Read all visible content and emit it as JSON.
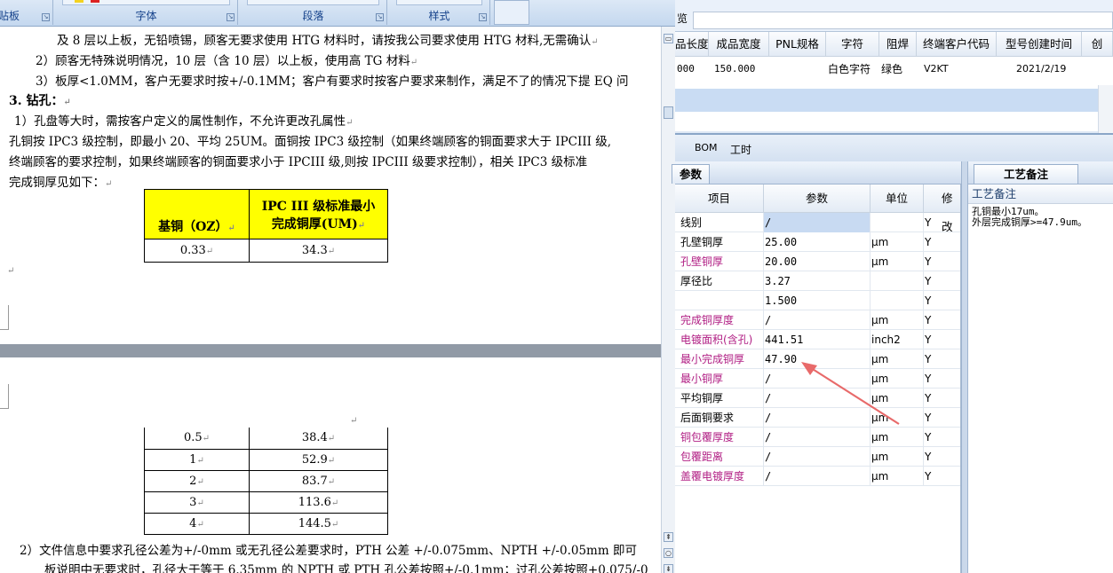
{
  "ribbon": {
    "groups": [
      {
        "label": "剪贴板"
      },
      {
        "label": "字体"
      },
      {
        "label": "段落"
      },
      {
        "label": "样式"
      }
    ]
  },
  "document": {
    "lines": [
      "及 8 层以上板，无铅喷锡，顾客无要求使用 HTG 材料时，请按我公司要求使用 HTG 材料,无需确认",
      "2）顾客无特殊说明情况，10 层（含 10 层）以上板，使用高 TG 材料",
      "3）板厚<1.0MM，客户无要求时按+/-0.1MM；客户有要求时按客户要求来制作，满足不了的情况下提 EQ 问",
      "3.   钻孔：",
      "1）孔盘等大时，需按客户定义的属性制作，不允许更改孔属性",
      "孔铜按 IPC3 级控制，即最小 20、平均 25UM。面铜按 IPC3 级控制（如果终端顾客的铜面要求大于 IPCIII 级,",
      "终端顾客的要求控制，如果终端顾客的铜面要求小于 IPCIII 级,则按 IPCIII 级要求控制），相关 IPC3 级标准",
      "完成铜厚见如下："
    ],
    "table": {
      "header": [
        "基铜（OZ）",
        "IPC III 级标准最小",
        "完成铜厚(UM)"
      ],
      "rows_top": [
        [
          "0.33",
          "34.3"
        ]
      ],
      "rows_bottom": [
        [
          "0.5",
          "38.4"
        ],
        [
          "1",
          "52.9"
        ],
        [
          "2",
          "83.7"
        ],
        [
          "3",
          "113.6"
        ],
        [
          "4",
          "144.5"
        ]
      ]
    },
    "lines_bottom": [
      "2）文件信息中要求孔径公差为+/-0mm 或无孔径公差要求时，PTH 公差  +/-0.075mm、NPTH +/-0.05mm 即可",
      "板说明中无要求时，孔径大于等于 6.35mm 的 NPTH 或 PTH 孔公差按照+/-0.1mm；过孔公差按照+0.075/-0"
    ]
  },
  "erp": {
    "top_label": "览",
    "grid_headers": [
      "品长度",
      "成品宽度",
      "PNL规格",
      "字符",
      "阻焊",
      "终端客户代码",
      "型号创建时间",
      "创"
    ],
    "grid_row": [
      "000",
      "150.000",
      "",
      "白色字符",
      "绿色",
      "V2KT",
      "2021/2/19",
      ""
    ],
    "tabs": [
      "BOM",
      "工时"
    ],
    "param_panel_title": "参数",
    "notes_panel_title": "工艺备注",
    "param_headers": [
      "项目",
      "参数",
      "单位",
      "修改"
    ],
    "param_rows": [
      {
        "item": "线别",
        "param": "/",
        "unit": "",
        "mod": "Y",
        "pink": false
      },
      {
        "item": "孔壁铜厚",
        "param": "25.00",
        "unit": "μm",
        "mod": "Y",
        "pink": false
      },
      {
        "item": "孔壁铜厚",
        "param": "20.00",
        "unit": "μm",
        "mod": "Y",
        "pink": true
      },
      {
        "item": "厚径比",
        "param": "3.27",
        "unit": "",
        "mod": "Y",
        "pink": false
      },
      {
        "item": "",
        "param": "1.500",
        "unit": "",
        "mod": "Y",
        "pink": false
      },
      {
        "item": "完成铜厚度",
        "param": "/",
        "unit": "μm",
        "mod": "Y",
        "pink": true
      },
      {
        "item": "电镀面积(含孔)",
        "param": "441.51",
        "unit": "inch2",
        "mod": "Y",
        "pink": true
      },
      {
        "item": "最小完成铜厚",
        "param": "47.90",
        "unit": "μm",
        "mod": "Y",
        "pink": true
      },
      {
        "item": "最小铜厚",
        "param": "/",
        "unit": "μm",
        "mod": "Y",
        "pink": true
      },
      {
        "item": "平均铜厚",
        "param": "/",
        "unit": "μm",
        "mod": "Y",
        "pink": false
      },
      {
        "item": "后面铜要求",
        "param": "/",
        "unit": "μm",
        "mod": "Y",
        "pink": false
      },
      {
        "item": "铜包覆厚度",
        "param": "/",
        "unit": "μm",
        "mod": "Y",
        "pink": true
      },
      {
        "item": "包覆距离",
        "param": "/",
        "unit": "μm",
        "mod": "Y",
        "pink": true
      },
      {
        "item": "盖覆电镀厚度",
        "param": "/",
        "unit": "μm",
        "mod": "Y",
        "pink": true
      }
    ],
    "notes_header": "工艺备注",
    "notes_lines": [
      "孔铜最小17um。",
      "外层完成铜厚>=47.9um。"
    ]
  }
}
